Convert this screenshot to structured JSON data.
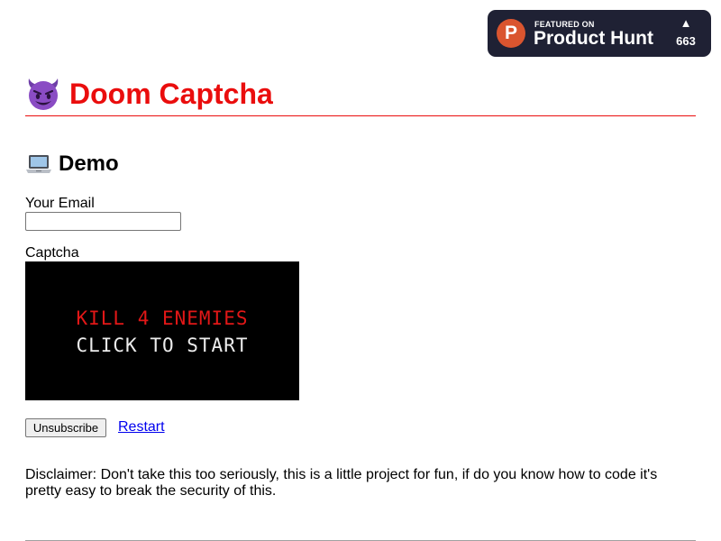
{
  "product_hunt": {
    "logo_letter": "P",
    "featured_text": "FEATURED ON",
    "name": "Product Hunt",
    "upvote_count": "663",
    "upvote_icon": "triangle-up-icon",
    "logo_color": "#da552f",
    "badge_color": "#1f2134"
  },
  "header": {
    "title": "Doom Captcha",
    "icon": "smiling-devil-icon",
    "accent_color": "#ea0d0d"
  },
  "demo": {
    "heading": "Demo",
    "heading_icon": "laptop-icon",
    "email_label": "Your Email",
    "email_value": "",
    "captcha_label": "Captcha",
    "game": {
      "line_1": "KILL 4 ENEMIES",
      "line_2": "CLICK TO START"
    },
    "unsubscribe_label": "Unsubscribe",
    "restart_label": "Restart"
  },
  "disclaimer": "Disclaimer: Don't take this too seriously, this is a little project for fun, if do you know how to code it's pretty easy to break the security of this."
}
